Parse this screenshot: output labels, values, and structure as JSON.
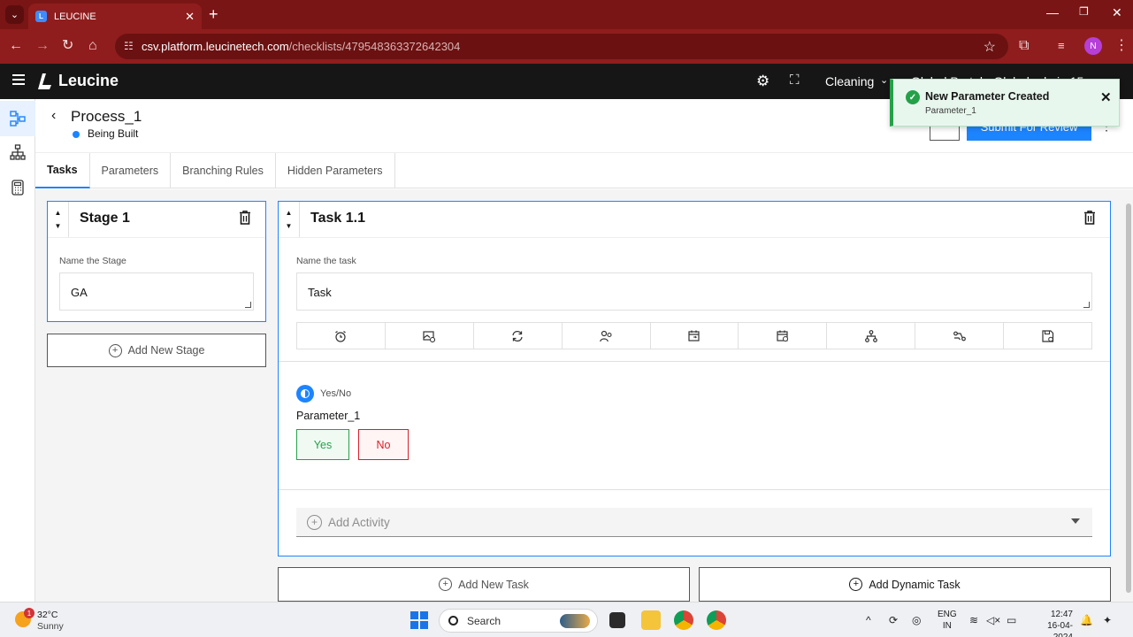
{
  "browser": {
    "tab_title": "LEUCINE",
    "url_host": "csv.platform.leucinetech.com",
    "url_path": "/checklists/479548363372642304",
    "profile_initial": "N"
  },
  "app": {
    "brand": "Leucine",
    "facility": "Cleaning",
    "user_peek": "Global Portal · Global admin 15"
  },
  "process": {
    "back_label": "‹",
    "name": "Process_1",
    "status": "Being Built",
    "submit_label": "Submit For Review"
  },
  "tabs": [
    {
      "label": "Tasks"
    },
    {
      "label": "Parameters"
    },
    {
      "label": "Branching Rules"
    },
    {
      "label": "Hidden Parameters"
    }
  ],
  "stage": {
    "title": "Stage 1",
    "name_label": "Name the Stage",
    "name_value": "GA",
    "add_label": "Add New Stage"
  },
  "task": {
    "title": "Task 1.1",
    "name_label": "Name the task",
    "name_value": "Task",
    "toolbar_icons": [
      "timer-icon",
      "media-icon",
      "recurrence-icon",
      "assignee-icon",
      "schedule-icon",
      "due-date-icon",
      "branching-icon",
      "automation-icon",
      "save-icon"
    ],
    "parameter": {
      "type": "Yes/No",
      "name": "Parameter_1",
      "yes_label": "Yes",
      "no_label": "No"
    },
    "add_activity_label": "Add Activity",
    "add_task_label": "Add New Task",
    "add_dynamic_task_label": "Add Dynamic Task"
  },
  "toast": {
    "title": "New Parameter Created",
    "subtitle": "Parameter_1"
  },
  "taskbar": {
    "temperature": "32°C",
    "condition": "Sunny",
    "weather_badge": "1",
    "search_placeholder": "Search",
    "lang_line1": "ENG",
    "lang_line2": "IN",
    "time": "12:47",
    "date": "16-04-2024"
  },
  "colors": {
    "browser_frame": "#8f1d1d",
    "app_header": "#161616",
    "accent": "#1d84ff",
    "success": "#24a148",
    "danger": "#da1e28"
  }
}
